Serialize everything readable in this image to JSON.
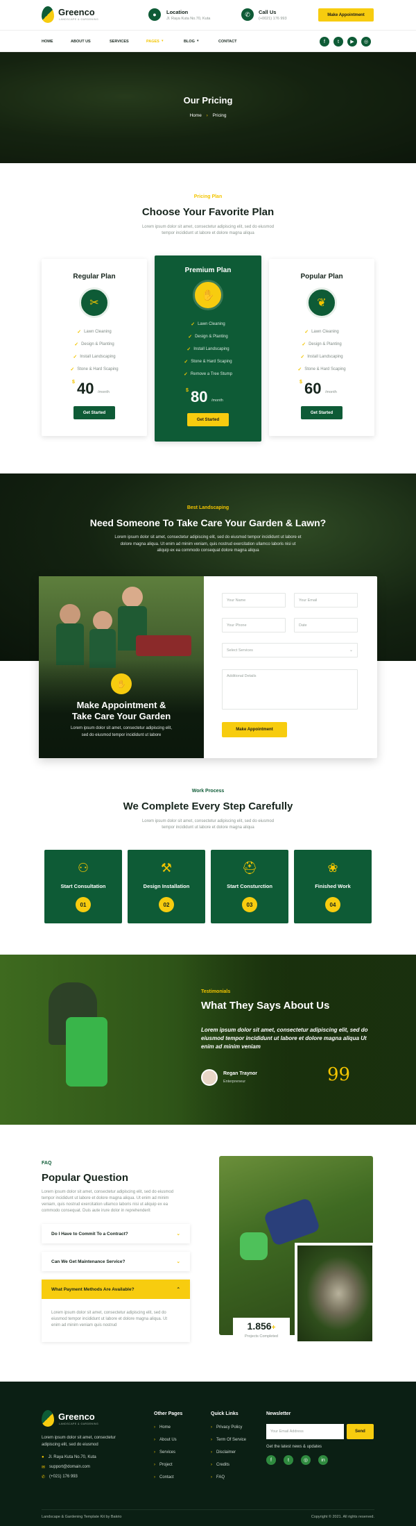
{
  "header": {
    "brand": "Greenco",
    "tagline": "LANDSCAPE & GARDENING",
    "location_label": "Location",
    "location_value": "Jl. Raya Kuta No.70, Kuta",
    "call_label": "Call Us",
    "call_value": "(+0021) 176 993",
    "cta": "Make Appointment",
    "nav": [
      "HOME",
      "ABOUT US",
      "SERVICES",
      "PAGES",
      "BLOG",
      "CONTACT"
    ],
    "nav_active": "PAGES",
    "social_icons": [
      "facebook-icon",
      "twitter-icon",
      "youtube-icon",
      "instagram-icon"
    ]
  },
  "hero": {
    "title": "Our Pricing",
    "crumb_home": "Home",
    "crumb_sep": "›",
    "crumb_current": "Pricing"
  },
  "pricing": {
    "kicker": "Pricing Plan",
    "title": "Choose Your Favorite Plan",
    "desc_1": "Lorem ipsum dolor sit amet, consectetur adipiscing elit, sed do eiusmod",
    "desc_2": "tempor incididunt ut labore et dolore magna aliqua",
    "plans": [
      {
        "name": "Regular Plan",
        "features": [
          "Lawn Cleaning",
          "Design & Planting",
          "Install Landscaping",
          "Stone & Hard Scaping"
        ],
        "currency": "$",
        "price": "40",
        "period": "/month",
        "button": "Get Started"
      },
      {
        "name": "Premium Plan",
        "features": [
          "Lawn Cleaning",
          "Design & Planting",
          "Install Landscaping",
          "Stone & Hard Scaping",
          "Remove a Tree Stump"
        ],
        "currency": "$",
        "price": "80",
        "period": "/month",
        "button": "Get Started"
      },
      {
        "name": "Popular Plan",
        "features": [
          "Lawn Cleaning",
          "Design & Planting",
          "Install Landscaping",
          "Stone & Hard Scaping"
        ],
        "currency": "$",
        "price": "60",
        "period": "/month",
        "button": "Get Started"
      }
    ]
  },
  "appointment": {
    "kicker": "Best Landscaping",
    "title": "Need Someone To Take Care Your Garden & Lawn?",
    "desc_1": "Lorem ipsum dolor sit amet, consectetur adipiscing elit, sed do eiusmod tempor incididunt ut labore et",
    "desc_2": "dolore magna aliqua. Ut enim ad minim veniam, quis nostrud exercitation ullamco laboris nisi ut",
    "desc_3": "aliquip ex ea commodo consequat dolore magna aliqua",
    "overlay_title_1": "Make Appointment &",
    "overlay_title_2": "Take Care Your Garden",
    "overlay_desc_1": "Lorem ipsum dolor sit amet, consectetur adipiscing elit,",
    "overlay_desc_2": "sed do eiusmod tempor incididunt ut labore",
    "ph_name": "Your Name",
    "ph_email": "Your Email",
    "ph_phone": "Your Phone",
    "ph_date": "Date",
    "ph_service": "Select Services",
    "ph_details": "Additional Details",
    "button": "Make Appointment"
  },
  "process": {
    "kicker": "Work Process",
    "title": "We Complete Every Step Carefully",
    "desc_1": "Lorem ipsum dolor sit amet, consectetur adipiscing elit, sed do eiusmod",
    "desc_2": "tempor incididunt ut labore et dolore magna aliqua",
    "steps": [
      {
        "label": "Start Consultation",
        "num": "01"
      },
      {
        "label": "Design Installation",
        "num": "02"
      },
      {
        "label": "Start Consturction",
        "num": "03"
      },
      {
        "label": "Finished Work",
        "num": "04"
      }
    ]
  },
  "testimonial": {
    "kicker": "Testimonials",
    "title": "What They Says About Us",
    "quote_1": "Lorem ipsum dolor sit amet, consectetur adipiscing elit, sed do",
    "quote_2": "eiusmod tempor incididunt ut labore et dolore magna aliqua Ut",
    "quote_3": "enim ad minim veniam",
    "name": "Regan Traynor",
    "role": "Enterpreneur",
    "quote_mark": "99"
  },
  "faq": {
    "kicker": "FAQ",
    "title": "Popular Question",
    "desc_1": "Lorem ipsum dolor sit amet, consectetur adipiscing elit, sed do eiusmod",
    "desc_2": "tempor incididunt ut labore et dolore magna aliqua. Ut enim ad minim",
    "desc_3": "veniam, quis nostrud exercitation ullamco laboris nisi ut aliquip ex ea",
    "desc_4": "commodo consequat. Duis aute irure dolor in reprehenderit",
    "q1": "Do I Have to Commit To a Contract?",
    "q2": "Can We Get Maintenance Service?",
    "q3": "What Payment Methods Are Available?",
    "a3_1": "Lorem ipsum dolor sit amet, consectetur adipiscing elit, sed do",
    "a3_2": "eiusmod tempor incididunt ut labore et dolore magna aliqua. Ut",
    "a3_3": "enim ad minim veniam quis nostrud",
    "stat_value": "1.856",
    "stat_plus": "+",
    "stat_label": "Projects Completed"
  },
  "footer": {
    "brand": "Greenco",
    "tagline": "LANDSCAPE & GARDENING",
    "desc_1": "Lorem ipsum dolor sit amet, consectetur",
    "desc_2": "adipiscing elit, sed do eiusmod",
    "address": "Jl. Raya Kuta No.70, Kuta",
    "email": "support@domain.com",
    "phone": "(+021) 176 993",
    "other_pages_title": "Other Pages",
    "other_pages": [
      "Home",
      "About Us",
      "Services",
      "Project",
      "Contact"
    ],
    "quick_links_title": "Quick Links",
    "quick_links": [
      "Privacy Policy",
      "Term Of Service",
      "Disclaimer",
      "Credits",
      "FAQ"
    ],
    "newsletter_title": "Newsletter",
    "newsletter_placeholder": "Your Email Address",
    "newsletter_button": "Send",
    "newsletter_note": "Get the latest news & updates",
    "bottom_left": "Landscape & Gardening Template Kit by Bakrio",
    "bottom_right": "Copyright © 2021. All rights reserved."
  },
  "colors": {
    "primary": "#0e5b36",
    "accent": "#f7cc0f",
    "dark": "#0b1f14"
  }
}
